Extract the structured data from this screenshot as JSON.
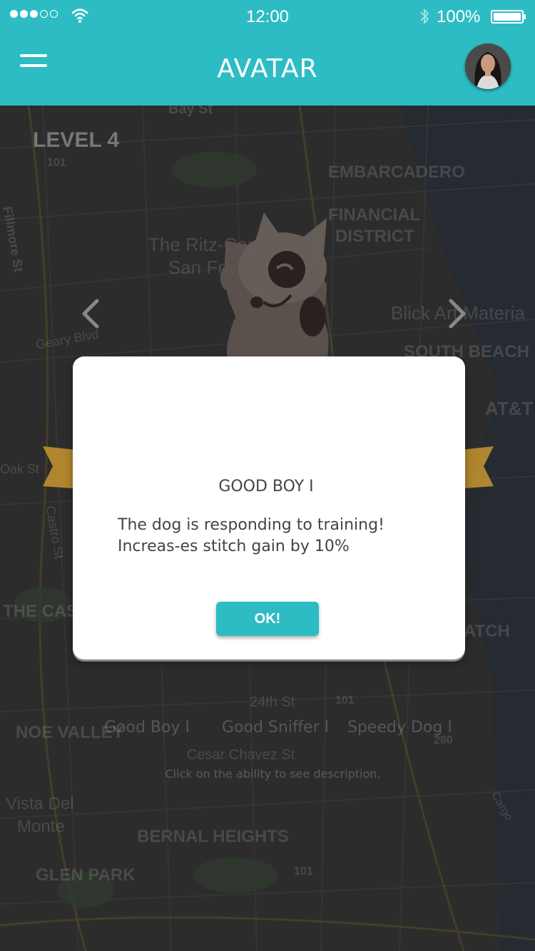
{
  "status_bar": {
    "time": "12:00",
    "battery": "100%",
    "signal_dots": [
      "filled",
      "filled",
      "filled",
      "empty",
      "empty"
    ]
  },
  "nav": {
    "title": "AVATAR",
    "menu_icon": "hamburger-menu-icon",
    "avatar": "profile-avatar"
  },
  "map_labels": [
    "Bay St",
    "101",
    "EMBARCADERO",
    "FINANCIAL",
    "DISTRICT",
    "Fillmore St",
    "The Ritz-Car",
    "San Fra",
    "Blick Art Materia",
    "Geary Blvd",
    "SOUTH BEACH",
    "AT&T",
    "Oak St",
    "Castro St",
    "THE CAS",
    "ATCH",
    "24th St",
    "101",
    "NOE VALLEY",
    "280",
    "Cesar Chavez St",
    "Vista Del",
    "Monte",
    "BERNAL HEIGHTS",
    "GLEN PARK",
    "101",
    "Cargo"
  ],
  "level": "LEVEL 4",
  "abilities": [
    "Good Boy I",
    "Good Sniffer I",
    "Speedy Dog I"
  ],
  "hint": "Click on the ability to see description.",
  "modal": {
    "title": "GOOD BOY I",
    "description": "The dog is responding to training! Increas-es stitch gain by 10%",
    "ok_label": "OK!"
  },
  "colors": {
    "accent": "#2ebcc4",
    "ribbon": "#c8952f",
    "dim_background": "#2c2c2c"
  }
}
